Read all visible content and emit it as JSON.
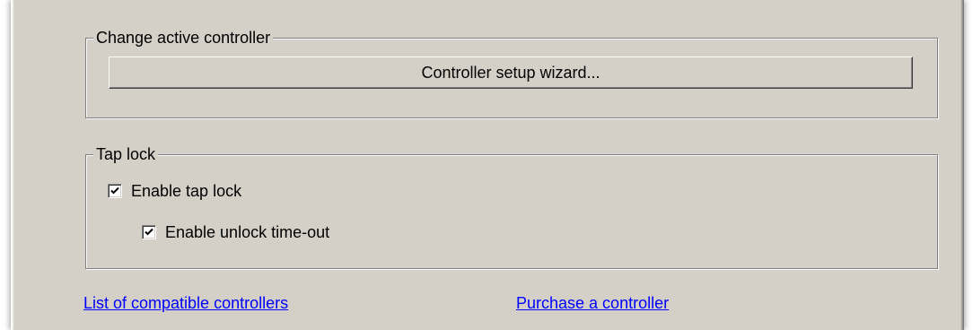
{
  "controller_group": {
    "title": "Change active controller",
    "wizard_button_label": "Controller setup wizard..."
  },
  "tap_lock_group": {
    "title": "Tap lock",
    "enable_tap_lock": {
      "label": "Enable tap lock",
      "checked": true
    },
    "enable_unlock_timeout": {
      "label": "Enable unlock time-out",
      "checked": true
    }
  },
  "links": {
    "compatible_controllers": "List of compatible controllers",
    "purchase_controller": "Purchase a controller"
  },
  "colors": {
    "dialog_bg": "#d4d0c8",
    "link": "#0000ff"
  }
}
